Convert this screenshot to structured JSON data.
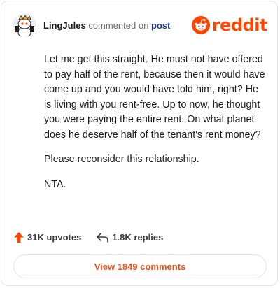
{
  "header": {
    "username": "LingJules",
    "action_text": "commented on",
    "post_link": "post",
    "brand": "reddit",
    "brand_color": "#ff4500",
    "avatar_icon": "snoo-avatar-icon"
  },
  "comment": {
    "paragraphs": [
      "Let me get this straight. He must not have offered to pay half of the rent, because then it would have come up and you would have told him, right? He is living with you rent-free. Up to now, he thought you were paying the entire rent. On what planet does he deserve half of the tenant's rent money?",
      "Please reconsider this relationship.",
      "NTA."
    ]
  },
  "stats": {
    "upvotes": "31K upvotes",
    "replies": "1.8K replies"
  },
  "footer": {
    "view_comments": "View 1849 comments"
  }
}
